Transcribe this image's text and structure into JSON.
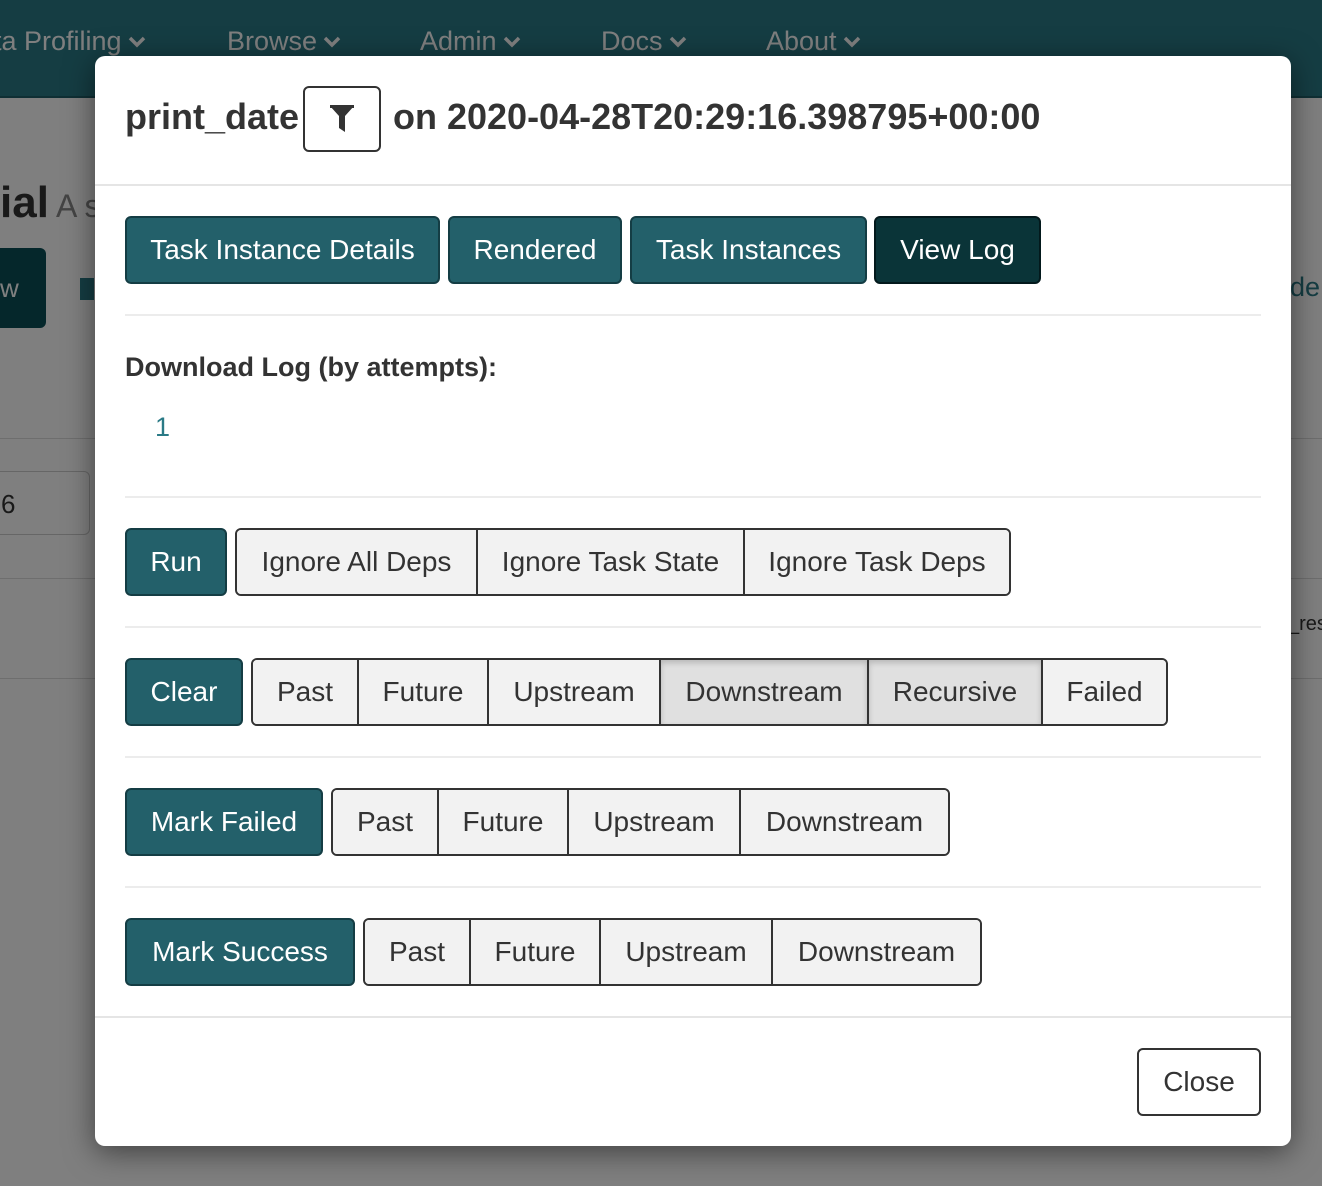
{
  "navbar": {
    "items": [
      {
        "label": "ta Profiling"
      },
      {
        "label": "Browse"
      },
      {
        "label": "Admin"
      },
      {
        "label": "Docs"
      },
      {
        "label": "About"
      }
    ]
  },
  "background": {
    "title": "ial",
    "subtitle": "A s",
    "left_button": "w",
    "right_text": "de",
    "input_value": "6",
    "row_text": "_res"
  },
  "modal": {
    "task_id": "print_date",
    "date_text": "on 2020-04-28T20:29:16.398795+00:00",
    "tabs": [
      {
        "label": "Task Instance Details"
      },
      {
        "label": "Rendered"
      },
      {
        "label": "Task Instances"
      },
      {
        "label": "View Log"
      }
    ],
    "download_log": {
      "label": "Download Log (by attempts):",
      "attempts": [
        "1"
      ]
    },
    "run": {
      "label": "Run",
      "options": [
        "Ignore All Deps",
        "Ignore Task State",
        "Ignore Task Deps"
      ]
    },
    "clear": {
      "label": "Clear",
      "options": [
        "Past",
        "Future",
        "Upstream",
        "Downstream",
        "Recursive",
        "Failed"
      ]
    },
    "mark_failed": {
      "label": "Mark Failed",
      "options": [
        "Past",
        "Future",
        "Upstream",
        "Downstream"
      ]
    },
    "mark_success": {
      "label": "Mark Success",
      "options": [
        "Past",
        "Future",
        "Upstream",
        "Downstream"
      ]
    },
    "close_label": "Close"
  },
  "colors": {
    "navbar": "#2a7a86",
    "primary_button": "#23606a",
    "active_tab": "#0a3438",
    "link": "#2a7a86"
  }
}
